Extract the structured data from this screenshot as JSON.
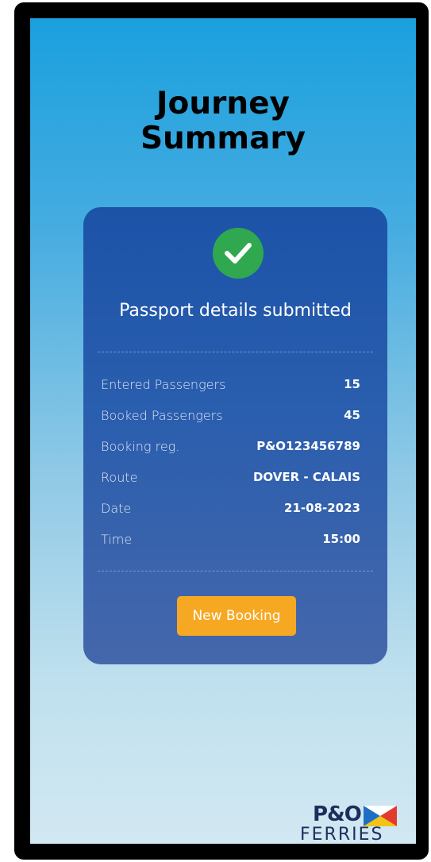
{
  "header": {
    "title_line1": "Journey",
    "title_line2": "Summary"
  },
  "card": {
    "status_icon": "checkmark-circle-icon",
    "status_text": "Passport details submitted",
    "details": [
      {
        "label": "Entered Passengers",
        "value": "15"
      },
      {
        "label": "Booked Passengers",
        "value": "45"
      },
      {
        "label": "Booking reg.",
        "value": "P&O123456789"
      },
      {
        "label": "Route",
        "value": "DOVER - CALAIS"
      },
      {
        "label": "Date",
        "value": "21-08-2023"
      },
      {
        "label": "Time",
        "value": "15:00"
      }
    ],
    "button_label": "New Booking"
  },
  "brand": {
    "name_top": "P&O",
    "name_bottom": "FERRIES",
    "logo_icon": "p-and-o-flag-icon"
  },
  "colors": {
    "background_top": "#1aa0de",
    "background_bottom": "#d2e8f2",
    "card": "#2a5eae",
    "success": "#2fa84f",
    "button": "#f7a823",
    "brand_navy": "#1b2f5c"
  }
}
